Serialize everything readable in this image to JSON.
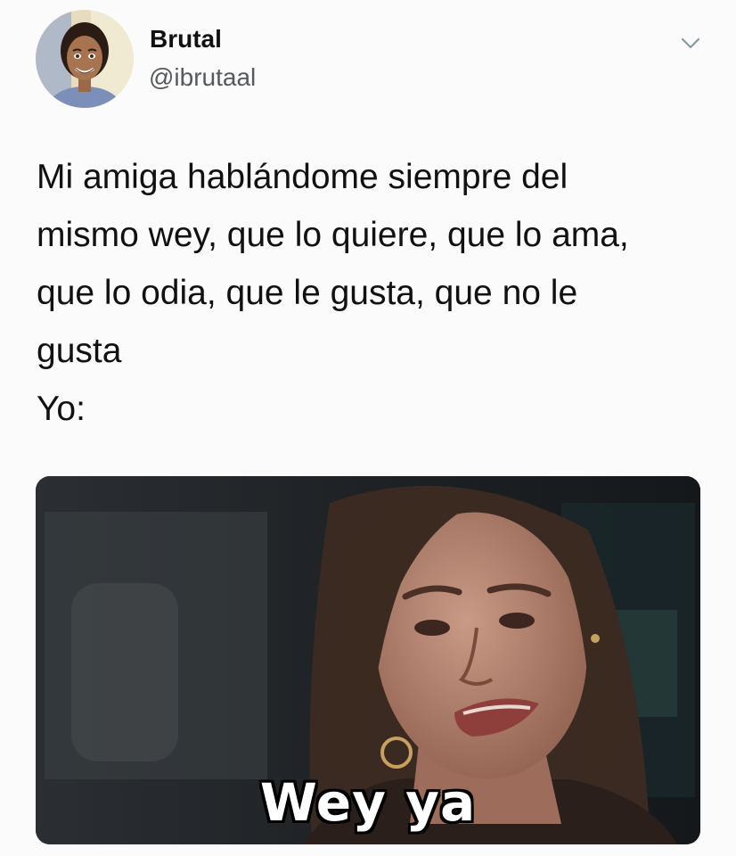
{
  "author": {
    "display_name": "Brutal",
    "handle": "@ibrutaal",
    "avatar_icon": "cartoon-avatar-icon"
  },
  "menu": {
    "icon": "chevron-down-icon"
  },
  "tweet": {
    "text_lines": [
      "Mi amiga hablándome siempre del",
      "mismo wey, que lo quiere, que lo ama,",
      "que lo odia, que le gusta, que no le",
      "gusta",
      "Yo:"
    ]
  },
  "media": {
    "caption": "Wey ya"
  },
  "colors": {
    "background": "#fbfbfb",
    "text": "#111111",
    "secondary_text": "#555a5f",
    "caret": "#8899a6"
  }
}
